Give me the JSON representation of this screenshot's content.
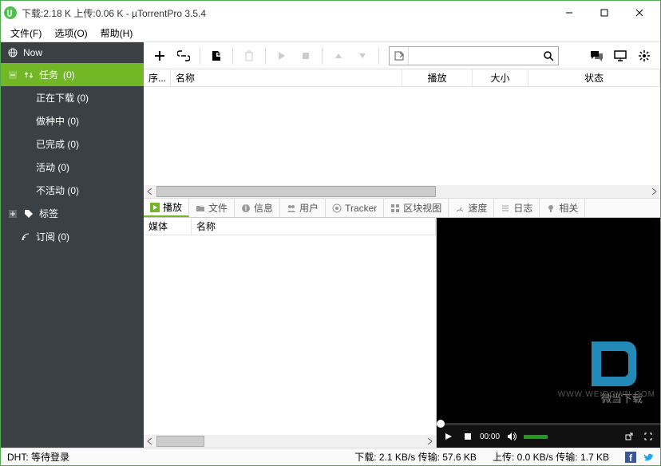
{
  "titlebar": {
    "title": "下载:2.18 K 上传:0.06 K - µTorrentPro 3.5.4"
  },
  "menu": {
    "file": "文件(F)",
    "options": "选项(O)",
    "help": "帮助(H)"
  },
  "sidebar": {
    "now": "Now",
    "tasks_label": "任务",
    "tasks_count": "(0)",
    "downloading": "正在下载 (0)",
    "seeding": "做种中 (0)",
    "completed": "已完成 (0)",
    "active": "活动 (0)",
    "inactive": "不活动 (0)",
    "labels": "标签",
    "feeds": "订阅 (0)"
  },
  "columns": {
    "seq": "序...",
    "name": "名称",
    "play": "播放",
    "size": "大小",
    "status": "状态"
  },
  "tabs": {
    "play": "播放",
    "files": "文件",
    "info": "信息",
    "peers": "用户",
    "tracker": "Tracker",
    "pieces": "区块视图",
    "speed": "速度",
    "log": "日志",
    "related": "相关"
  },
  "media_cols": {
    "media": "媒体",
    "name": "名称"
  },
  "video": {
    "time": "00:00",
    "watermark": "WWW.WEIDOWN.COM",
    "wm_label": "微当下载"
  },
  "status": {
    "dht": "DHT: 等待登录",
    "down": "下载: 2.1 KB/s 传输: 57.6 KB",
    "up": "上传: 0.0 KB/s 传输: 1.7 KB"
  },
  "search": {
    "placeholder": ""
  }
}
